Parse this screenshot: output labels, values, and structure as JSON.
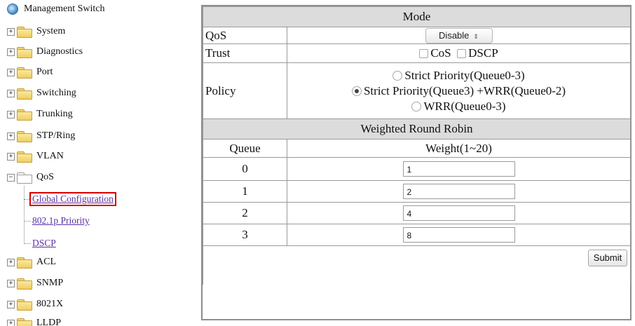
{
  "tree": {
    "root": "Management Switch",
    "items": [
      {
        "label": "System",
        "expanded": false
      },
      {
        "label": "Diagnostics",
        "expanded": false
      },
      {
        "label": "Port",
        "expanded": false
      },
      {
        "label": "Switching",
        "expanded": false
      },
      {
        "label": "Trunking",
        "expanded": false
      },
      {
        "label": "STP/Ring",
        "expanded": false
      },
      {
        "label": "VLAN",
        "expanded": false
      },
      {
        "label": "QoS",
        "expanded": true
      },
      {
        "label": "ACL",
        "expanded": false
      },
      {
        "label": "SNMP",
        "expanded": false
      },
      {
        "label": "8021X",
        "expanded": false
      },
      {
        "label": "LLDP",
        "expanded": false
      }
    ],
    "qos_children": [
      "Global Configuration",
      "802.1p Priority",
      "DSCP"
    ],
    "expand_symbol": "+",
    "collapse_symbol": "−"
  },
  "mode": {
    "header": "Mode",
    "qos_label": "QoS",
    "qos_value": "Disable",
    "select_arrow": "⇕",
    "trust_label": "Trust",
    "trust_options": [
      "CoS",
      "DSCP"
    ],
    "policy_label": "Policy",
    "policy_options": [
      "Strict Priority(Queue0-3)",
      "Strict Priority(Queue3) +WRR(Queue0-2)",
      "WRR(Queue0-3)"
    ],
    "policy_selected": 1
  },
  "wrr": {
    "header": "Weighted Round Robin",
    "queue_header": "Queue",
    "weight_header": "Weight(1~20)",
    "rows": [
      {
        "queue": "0",
        "weight": "1"
      },
      {
        "queue": "1",
        "weight": "2"
      },
      {
        "queue": "2",
        "weight": "4"
      },
      {
        "queue": "3",
        "weight": "8"
      }
    ]
  },
  "submit_label": "Submit",
  "colors": {
    "highlight": "#d40000",
    "link": "#5a2fa6",
    "header_bg": "#dcdcdc"
  }
}
